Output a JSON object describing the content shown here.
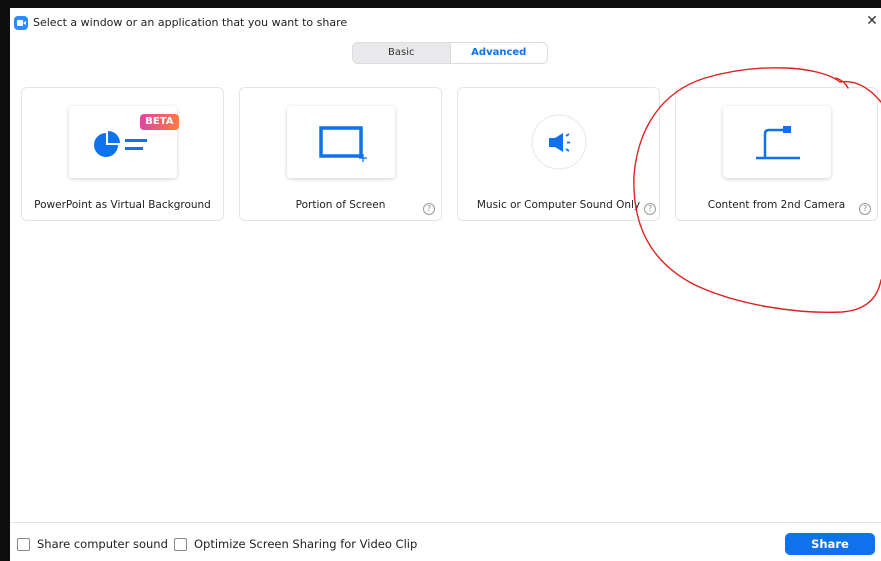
{
  "window": {
    "title": "Select a window or an application that you want to share",
    "close_glyph": "✕"
  },
  "tabs": [
    {
      "label": "Basic",
      "active": false
    },
    {
      "label": "Advanced",
      "active": true
    }
  ],
  "cards": [
    {
      "label": "PowerPoint as Virtual Background",
      "icon": "powerpoint-pie-icon",
      "badge": "BETA",
      "help": false
    },
    {
      "label": "Portion of Screen",
      "icon": "screen-portion-icon",
      "help": true
    },
    {
      "label": "Music or Computer Sound Only",
      "icon": "speaker-icon",
      "help": true
    },
    {
      "label": "Content from 2nd Camera",
      "icon": "document-camera-icon",
      "help": true
    }
  ],
  "help_glyph": "?",
  "footer": {
    "share_sound_label": "Share computer sound",
    "optimize_label": "Optimize Screen Sharing for Video Clip",
    "share_button": "Share"
  },
  "colors": {
    "accent": "#0e72ed",
    "icon_blue": "#0e72ed",
    "annotation": "#e02020"
  }
}
